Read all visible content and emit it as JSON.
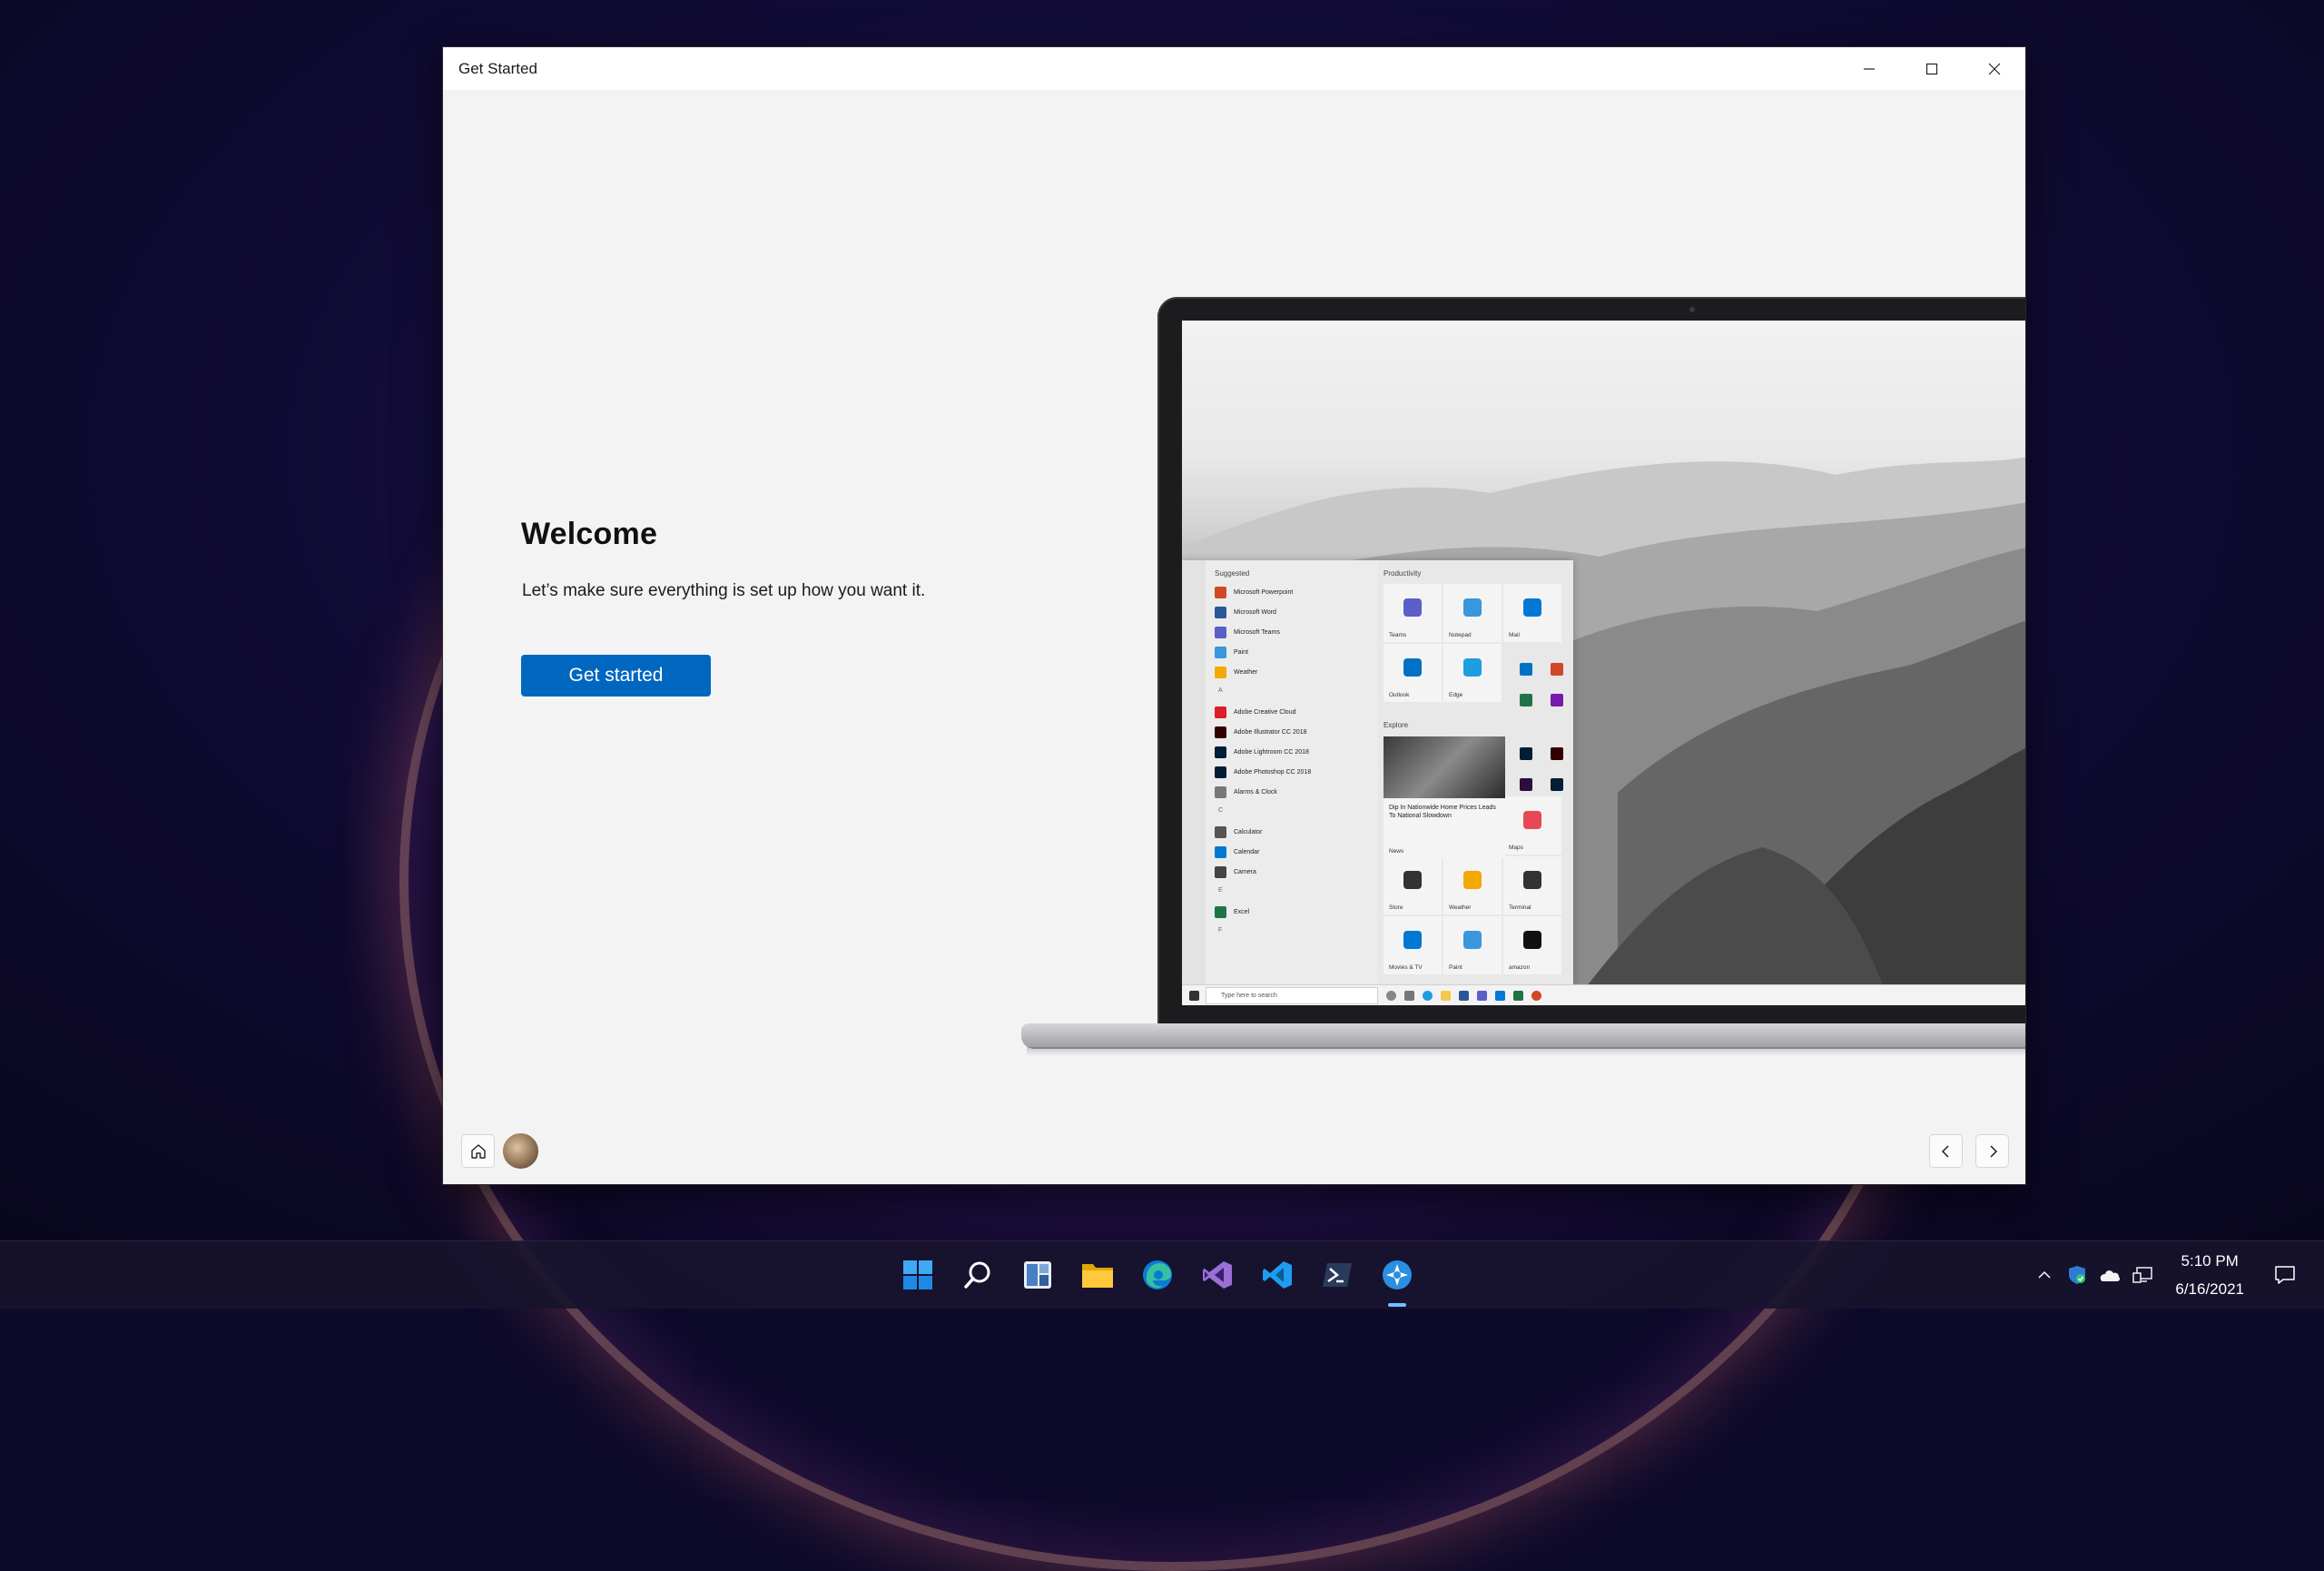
{
  "window": {
    "title": "Get Started"
  },
  "welcome": {
    "heading": "Welcome",
    "subtitle": "Let’s make sure everything is set up how you want it.",
    "button_label": "Get started"
  },
  "illustration": {
    "start_menu": {
      "suggested_heading": "Suggested",
      "productivity_heading": "Productivity",
      "explore_heading": "Explore",
      "list_items": [
        {
          "label": "Microsoft Powerpoint",
          "color": "#d24726"
        },
        {
          "label": "Microsoft Word",
          "color": "#2b579a"
        },
        {
          "label": "Microsoft Teams",
          "color": "#5b5fc7"
        },
        {
          "label": "Paint",
          "color": "#3a96dd"
        },
        {
          "label": "Weather",
          "color": "#f2a900"
        },
        {
          "letter": "A"
        },
        {
          "label": "Adobe Creative Cloud",
          "color": "#da1f26"
        },
        {
          "label": "Adobe Illustrator CC 2018",
          "color": "#330000"
        },
        {
          "label": "Adobe Lightroom CC 2018",
          "color": "#001e36"
        },
        {
          "label": "Adobe Photoshop CC 2018",
          "color": "#001e36"
        },
        {
          "label": "Alarms & Clock",
          "color": "#777777"
        },
        {
          "letter": "C"
        },
        {
          "label": "Calculator",
          "color": "#555555"
        },
        {
          "label": "Calendar",
          "color": "#0078d4"
        },
        {
          "label": "Camera",
          "color": "#444444"
        },
        {
          "letter": "E"
        },
        {
          "label": "Excel",
          "color": "#217346"
        },
        {
          "letter": "F"
        }
      ],
      "tiles": [
        {
          "label": "Teams",
          "color": "#5b5fc7"
        },
        {
          "label": "Notepad",
          "color": "#3a96dd"
        },
        {
          "label": "Mail",
          "color": "#0078d4"
        },
        {
          "label": "Outlook",
          "color": "#0072c6"
        },
        {
          "label": "Edge",
          "color": "#1e9de0"
        },
        {
          "label": "Maps",
          "color": "#e74856"
        },
        {
          "label": "Store",
          "color": "#333333"
        },
        {
          "label": "Weather",
          "color": "#f2a900"
        },
        {
          "label": "Terminal",
          "color": "#333333"
        },
        {
          "label": "Movies & TV",
          "color": "#0078d4"
        },
        {
          "label": "Paint",
          "color": "#3a96dd"
        },
        {
          "label": "amazon",
          "color": "#111111"
        }
      ],
      "news_text": "Dip In Nationwide Home Prices Leads To National Slowdown",
      "news_label": "News",
      "search_placeholder": "Type here to search"
    }
  },
  "navigation": {
    "home_icon": "home-icon",
    "back_icon": "chevron-left-icon",
    "forward_icon": "chevron-right-icon"
  },
  "taskbar": {
    "apps": [
      {
        "name": "start",
        "icon": "windows-logo-icon"
      },
      {
        "name": "search",
        "icon": "search-icon"
      },
      {
        "name": "widgets",
        "icon": "widgets-icon"
      },
      {
        "name": "file-explorer",
        "icon": "folder-icon"
      },
      {
        "name": "edge",
        "icon": "edge-icon"
      },
      {
        "name": "visual-studio",
        "icon": "visual-studio-icon"
      },
      {
        "name": "vs-code",
        "icon": "vscode-icon"
      },
      {
        "name": "powershell",
        "icon": "terminal-icon"
      },
      {
        "name": "get-started",
        "icon": "get-started-icon",
        "active": true
      }
    ],
    "time": "5:10 PM",
    "date": "6/16/2021"
  },
  "colors": {
    "accent": "#0067c0",
    "taskbar": "#18142e",
    "window_bg": "#f3f3f3"
  }
}
